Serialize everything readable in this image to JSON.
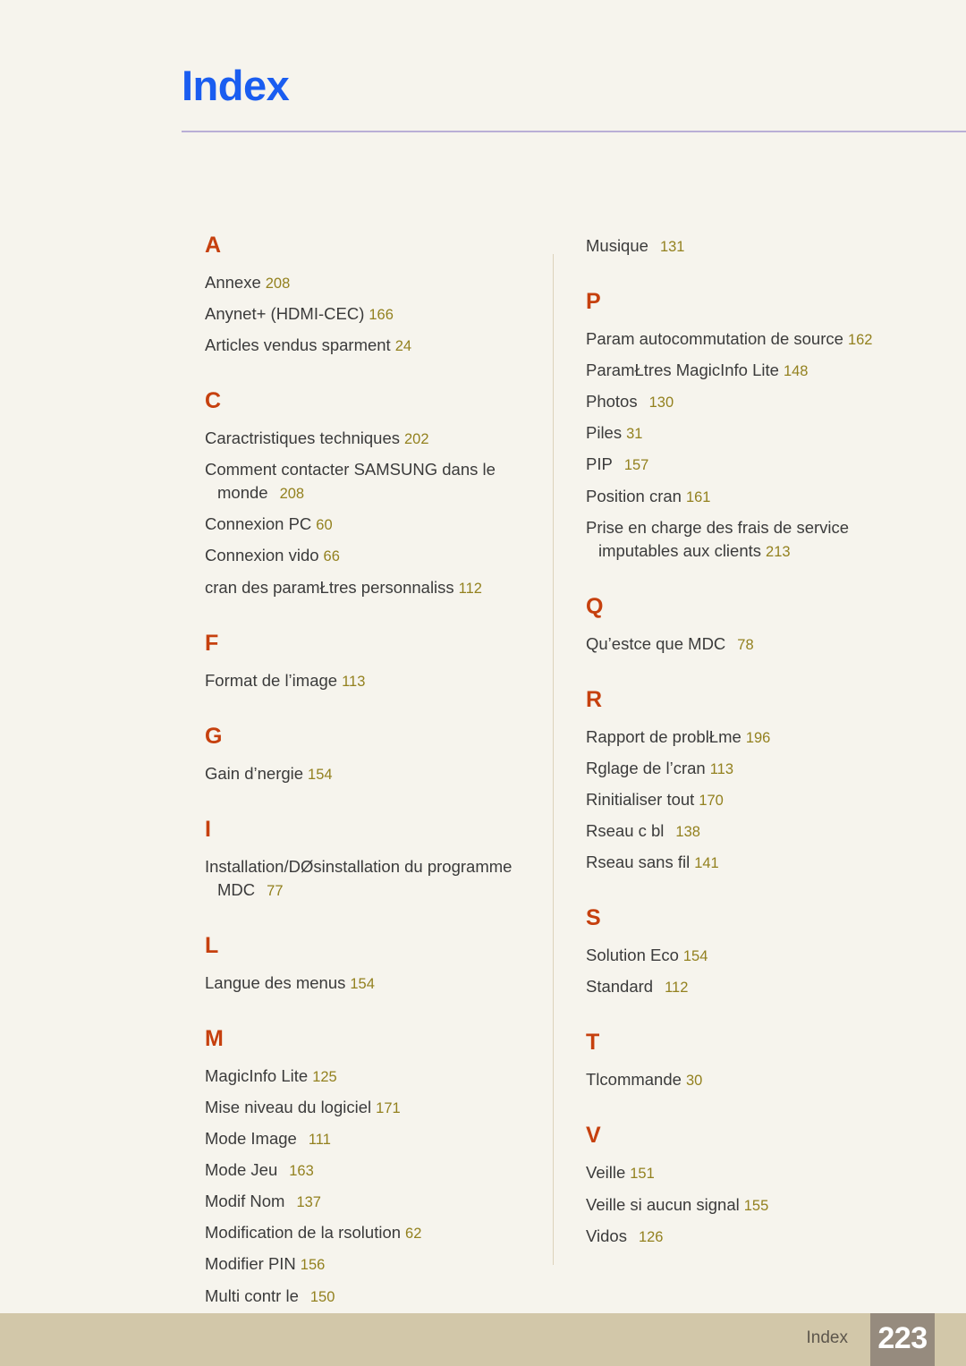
{
  "header": {
    "title": "Index",
    "title_color": "#1a5df0",
    "rule_color": "#b9aed6"
  },
  "footer": {
    "label": "Index",
    "page_number": "223",
    "band_color": "#d2c7a9",
    "box_color": "#968b7e"
  },
  "colors": {
    "page_background": "#f6f4ed",
    "section_letter": "#c6400e",
    "entry_text": "#3b3b3b",
    "page_ref": "#93811f",
    "divider": "#dcd2bb"
  },
  "columns": {
    "left": [
      {
        "letter": "A",
        "entries": [
          {
            "text": "Annexe",
            "page": "208",
            "gap": false
          },
          {
            "text": "Anynet+ (HDMI-CEC)",
            "page": "166",
            "gap": false
          },
          {
            "text": "Articles vendus sparment",
            "page": "24",
            "gap": false
          }
        ]
      },
      {
        "letter": "C",
        "entries": [
          {
            "text": "Caractristiques techniques",
            "page": "202",
            "gap": false
          },
          {
            "text": "Comment contacter SAMSUNG dans le monde",
            "page": "208",
            "gap": true
          },
          {
            "text": "Connexion PC",
            "page": "60",
            "gap": false
          },
          {
            "text": "Connexion vido",
            "page": "66",
            "gap": false
          },
          {
            "text": "cran des paramŁtres personnaliss",
            "page": "112",
            "gap": false
          }
        ]
      },
      {
        "letter": "F",
        "entries": [
          {
            "text": "Format de l’image",
            "page": "113",
            "gap": false
          }
        ]
      },
      {
        "letter": "G",
        "entries": [
          {
            "text": "Gain d’nergie",
            "page": "154",
            "gap": false
          }
        ]
      },
      {
        "letter": "I",
        "entries": [
          {
            "text": "Installation/DØsinstallation du programme MDC",
            "page": "77",
            "gap": true
          }
        ]
      },
      {
        "letter": "L",
        "entries": [
          {
            "text": "Langue des menus",
            "page": "154",
            "gap": false
          }
        ]
      },
      {
        "letter": "M",
        "entries": [
          {
            "text": "MagicInfo Lite",
            "page": "125",
            "gap": false
          },
          {
            "text": "Mise  niveau du logiciel",
            "page": "171",
            "gap": false
          },
          {
            "text": "Mode Image",
            "page": "111",
            "gap": true
          },
          {
            "text": "Mode Jeu",
            "page": "163",
            "gap": true
          },
          {
            "text": "Modif Nom",
            "page": "137",
            "gap": true
          },
          {
            "text": "Modification de la rsolution",
            "page": "62",
            "gap": false
          },
          {
            "text": "Modifier PIN",
            "page": "156",
            "gap": false
          },
          {
            "text": "Multi contr le",
            "page": "150",
            "gap": true
          }
        ]
      }
    ],
    "right": [
      {
        "letter": "",
        "entries": [
          {
            "text": "Musique",
            "page": "131",
            "gap": true
          }
        ]
      },
      {
        "letter": "P",
        "entries": [
          {
            "text": "Param autocommutation de source",
            "page": "162",
            "gap": false
          },
          {
            "text": "ParamŁtres MagicInfo Lite",
            "page": "148",
            "gap": false
          },
          {
            "text": "Photos",
            "page": "130",
            "gap": true
          },
          {
            "text": "Piles",
            "page": "31",
            "gap": false
          },
          {
            "text": "PIP",
            "page": "157",
            "gap": true
          },
          {
            "text": "Position cran",
            "page": "161",
            "gap": false
          },
          {
            "text": "Prise en charge des frais de service imputables aux clients",
            "page": "213",
            "gap": false
          }
        ]
      },
      {
        "letter": "Q",
        "entries": [
          {
            "text": "Qu’estce que MDC",
            "page": "78",
            "gap": true
          }
        ]
      },
      {
        "letter": "R",
        "entries": [
          {
            "text": "Rapport de problŁme",
            "page": "196",
            "gap": false
          },
          {
            "text": "Rglage de l’cran",
            "page": "113",
            "gap": false
          },
          {
            "text": "Rinitialiser tout",
            "page": "170",
            "gap": false
          },
          {
            "text": "Rseau c bl",
            "page": "138",
            "gap": true
          },
          {
            "text": "Rseau sans fil",
            "page": "141",
            "gap": false
          }
        ]
      },
      {
        "letter": "S",
        "entries": [
          {
            "text": "Solution Eco",
            "page": "154",
            "gap": false
          },
          {
            "text": "Standard",
            "page": "112",
            "gap": true
          }
        ]
      },
      {
        "letter": "T",
        "entries": [
          {
            "text": "Tlcommande",
            "page": "30",
            "gap": false
          }
        ]
      },
      {
        "letter": "V",
        "entries": [
          {
            "text": "Veille",
            "page": "151",
            "gap": false
          },
          {
            "text": "Veille si aucun signal",
            "page": "155",
            "gap": false
          },
          {
            "text": "Vidos",
            "page": "126",
            "gap": true
          }
        ]
      }
    ]
  }
}
